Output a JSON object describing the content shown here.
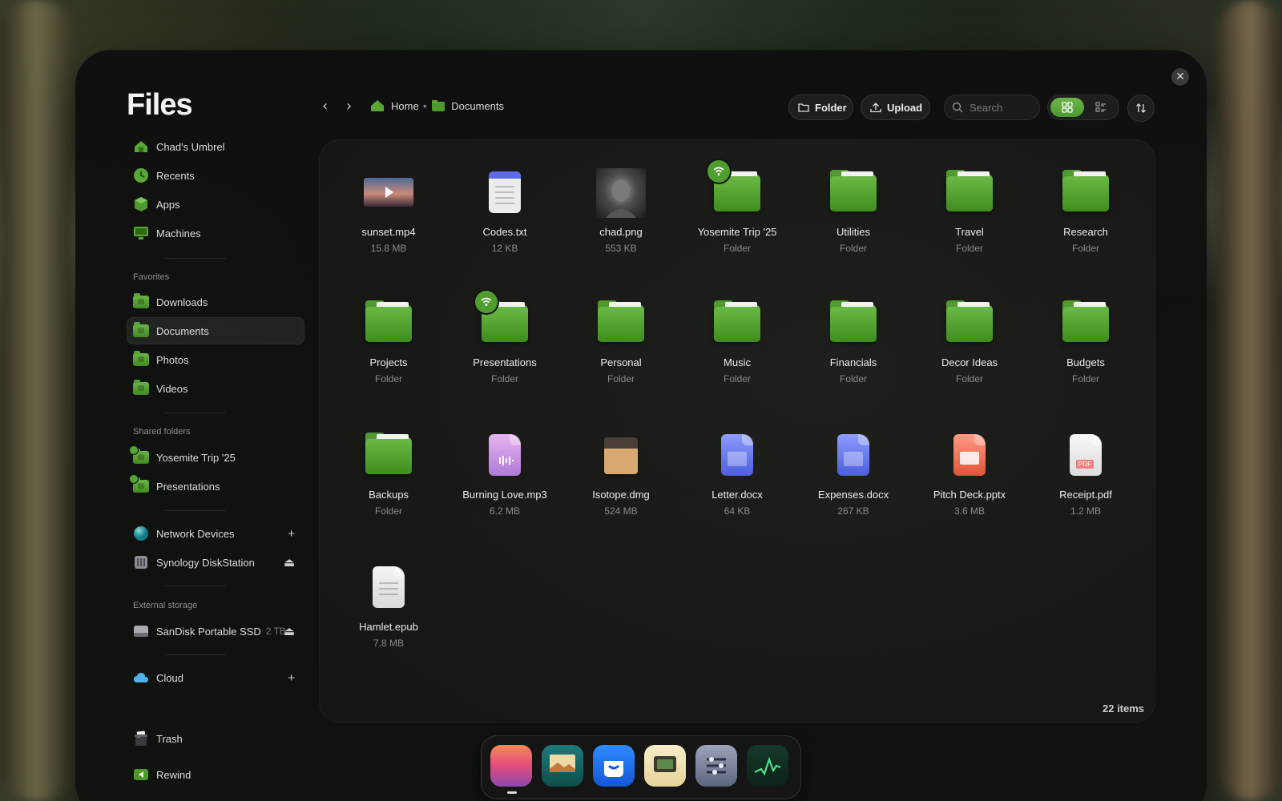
{
  "app_title": "Files",
  "sidebar": {
    "main": [
      {
        "label": "Chad's Umbrel"
      },
      {
        "label": "Recents"
      },
      {
        "label": "Apps"
      },
      {
        "label": "Machines"
      }
    ],
    "favorites_header": "Favorites",
    "favorites": [
      {
        "label": "Downloads"
      },
      {
        "label": "Documents"
      },
      {
        "label": "Photos"
      },
      {
        "label": "Videos"
      }
    ],
    "shared_header": "Shared folders",
    "shared": [
      {
        "label": "Yosemite Trip '25"
      },
      {
        "label": "Presentations"
      }
    ],
    "network": [
      {
        "label": "Network Devices"
      },
      {
        "label": "Synology DiskStation"
      }
    ],
    "external_header": "External storage",
    "external": [
      {
        "label": "SanDisk Portable SSD",
        "capacity": "2 TB"
      }
    ],
    "cloud": {
      "label": "Cloud"
    },
    "trash": {
      "label": "Trash"
    },
    "rewind": {
      "label": "Rewind"
    }
  },
  "breadcrumb": {
    "home": "Home",
    "current": "Documents"
  },
  "toolbar": {
    "folder_label": "Folder",
    "upload_label": "Upload",
    "search_placeholder": "Search"
  },
  "items": [
    {
      "name": "sunset.mp4",
      "meta": "15.8 MB",
      "kind": "video"
    },
    {
      "name": "Codes.txt",
      "meta": "12 KB",
      "kind": "txt"
    },
    {
      "name": "chad.png",
      "meta": "553 KB",
      "kind": "image"
    },
    {
      "name": "Yosemite Trip '25",
      "meta": "Folder",
      "kind": "folder-shared"
    },
    {
      "name": "Utilities",
      "meta": "Folder",
      "kind": "folder"
    },
    {
      "name": "Travel",
      "meta": "Folder",
      "kind": "folder"
    },
    {
      "name": "Research",
      "meta": "Folder",
      "kind": "folder"
    },
    {
      "name": "Projects",
      "meta": "Folder",
      "kind": "folder"
    },
    {
      "name": "Presentations",
      "meta": "Folder",
      "kind": "folder-shared"
    },
    {
      "name": "Personal",
      "meta": "Folder",
      "kind": "folder"
    },
    {
      "name": "Music",
      "meta": "Folder",
      "kind": "folder"
    },
    {
      "name": "Financials",
      "meta": "Folder",
      "kind": "folder"
    },
    {
      "name": "Decor Ideas",
      "meta": "Folder",
      "kind": "folder"
    },
    {
      "name": "Budgets",
      "meta": "Folder",
      "kind": "folder"
    },
    {
      "name": "Backups",
      "meta": "Folder",
      "kind": "folder"
    },
    {
      "name": "Burning Love.mp3",
      "meta": "6.2 MB",
      "kind": "audio"
    },
    {
      "name": "Isotope.dmg",
      "meta": "524 MB",
      "kind": "dmg"
    },
    {
      "name": "Letter.docx",
      "meta": "64 KB",
      "kind": "docx"
    },
    {
      "name": "Expenses.docx",
      "meta": "267 KB",
      "kind": "docx"
    },
    {
      "name": "Pitch Deck.pptx",
      "meta": "3.6 MB",
      "kind": "pptx"
    },
    {
      "name": "Receipt.pdf",
      "meta": "1.2 MB",
      "kind": "pdf",
      "badge": "PDF"
    },
    {
      "name": "Hamlet.epub",
      "meta": "7.8 MB",
      "kind": "epub"
    }
  ],
  "items_count": "22 items",
  "colors": {
    "accent": "#5aa637",
    "background": "#121312"
  }
}
